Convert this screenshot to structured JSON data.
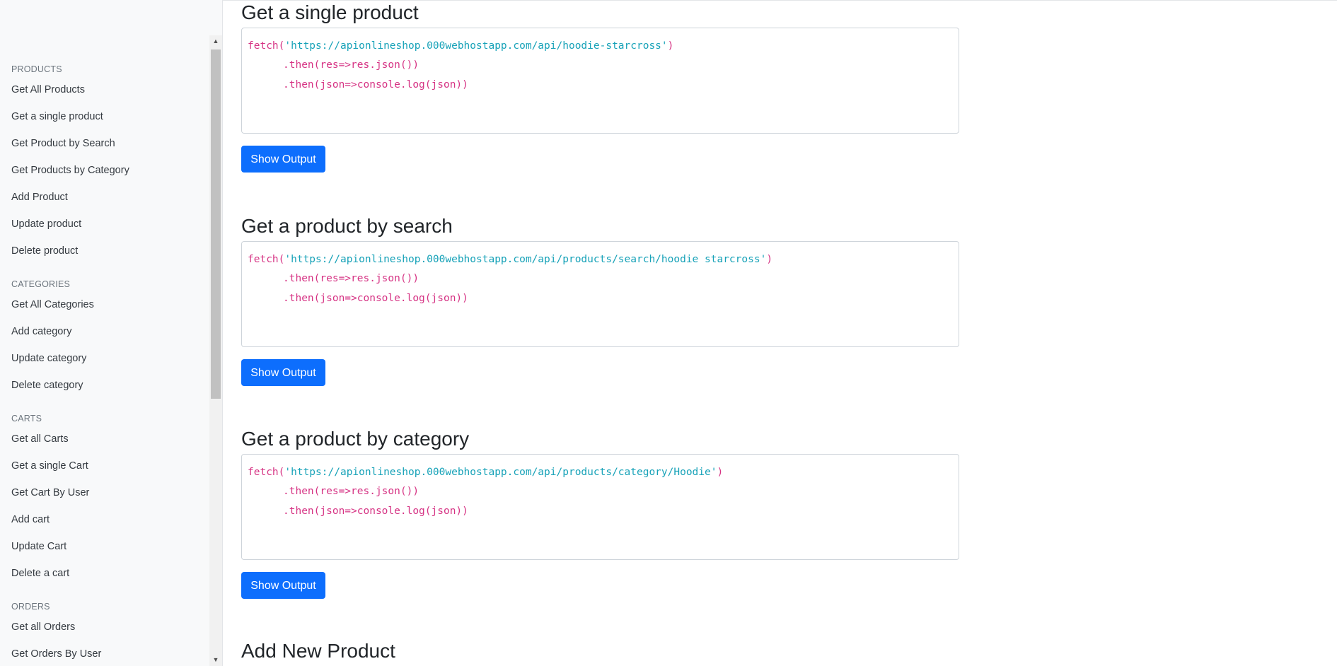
{
  "sidebar": {
    "sections": [
      {
        "heading": "PRODUCTS",
        "items": [
          "Get All Products",
          "Get a single product",
          "Get Product by Search",
          "Get Products by Category",
          "Add Product",
          "Update product",
          "Delete product"
        ]
      },
      {
        "heading": "CATEGORIES",
        "items": [
          "Get All Categories",
          "Add category",
          "Update category",
          "Delete category"
        ]
      },
      {
        "heading": "CARTS",
        "items": [
          "Get all Carts",
          "Get a single Cart",
          "Get Cart By User",
          "Add cart",
          "Update Cart",
          "Delete a cart"
        ]
      },
      {
        "heading": "ORDERS",
        "items": [
          "Get all Orders",
          "Get Orders By User"
        ]
      }
    ],
    "scroll_up_icon": "triangle-up",
    "scroll_down_icon": "triangle-down"
  },
  "main": {
    "sections": [
      {
        "title": "Get a single product",
        "code": {
          "fetch": "fetch(",
          "url": "'https://apionlineshop.000webhostapp.com/api/hoodie-starcross'",
          "close": ")",
          "then1": ".then(res=>res.json())",
          "then2": ".then(json=>console.log(json))"
        },
        "button": "Show Output"
      },
      {
        "title": "Get a product by search",
        "code": {
          "fetch": "fetch(",
          "url": "'https://apionlineshop.000webhostapp.com/api/products/search/hoodie starcross'",
          "close": ")",
          "then1": ".then(res=>res.json())",
          "then2": ".then(json=>console.log(json))"
        },
        "button": "Show Output"
      },
      {
        "title": "Get a product by category",
        "code": {
          "fetch": "fetch(",
          "url": "'https://apionlineshop.000webhostapp.com/api/products/category/Hoodie'",
          "close": ")",
          "then1": ".then(res=>res.json())",
          "then2": ".then(json=>console.log(json))"
        },
        "button": "Show Output"
      },
      {
        "title": "Add New Product"
      }
    ]
  },
  "colors": {
    "accent": "#0d6efd",
    "code_keyword": "#d63384",
    "code_string": "#17a2b8",
    "sidebar_bg": "#f8f9fa"
  }
}
